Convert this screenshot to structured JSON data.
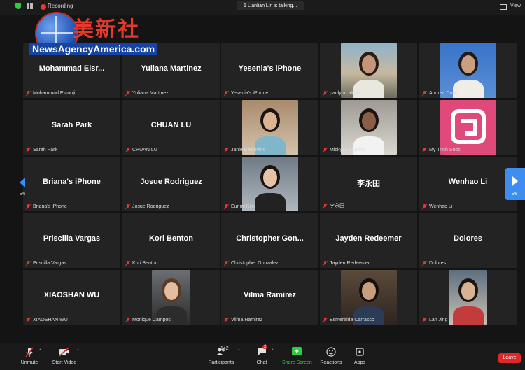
{
  "top_bar": {
    "recording_label": "Recording",
    "talking_indicator": "1 Lianlian Lin is talking...",
    "view_label": "View"
  },
  "watermark": {
    "chinese_text": "美新社",
    "english_text": "NewsAgencyAmerica.com"
  },
  "pagination": {
    "left_page": "5/6",
    "right_page": "5/6"
  },
  "participants": [
    {
      "name": "Mohammad Esrouji",
      "display": "Mohammad  Elsr...",
      "video": false
    },
    {
      "name": "Yuliana Martinez",
      "display": "Yuliana Martinez",
      "video": false
    },
    {
      "name": "Yesenia's iPhone",
      "display": "Yesenia's iPhone",
      "video": false
    },
    {
      "name": "paulynn alipio",
      "display": "",
      "video": true
    },
    {
      "name": "Andrea Colin",
      "display": "",
      "video": true
    },
    {
      "name": "Sarah Park",
      "display": "Sarah Park",
      "video": false
    },
    {
      "name": "CHUAN LU",
      "display": "CHUAN LU",
      "video": false
    },
    {
      "name": "Janie Baldovino",
      "display": "",
      "video": true
    },
    {
      "name": "Mickyas Shawel",
      "display": "",
      "video": true
    },
    {
      "name": "My Trinh Sooc",
      "display": "",
      "video": true
    },
    {
      "name": "Briana's iPhone",
      "display": "Briana's iPhone",
      "video": false
    },
    {
      "name": "Josue Rodriguez",
      "display": "Josue Rodriguez",
      "video": false
    },
    {
      "name": "Eunmi Kim",
      "display": "",
      "video": true
    },
    {
      "name": "李永田",
      "display": "李永田",
      "video": false
    },
    {
      "name": "Wenhao Li",
      "display": "Wenhao Li",
      "video": false
    },
    {
      "name": "Priscilla Vargas",
      "display": "Priscilla Vargas",
      "video": false
    },
    {
      "name": "Kori Benton",
      "display": "Kori Benton",
      "video": false
    },
    {
      "name": "Christopher Gonzalez",
      "display": "Christopher  Gon...",
      "video": false
    },
    {
      "name": "Jayden Redeemer",
      "display": "Jayden Redeemer",
      "video": false
    },
    {
      "name": "Dolores",
      "display": "Dolores",
      "video": false
    },
    {
      "name": "XIAOSHAN WU",
      "display": "XIAOSHAN WU",
      "video": false
    },
    {
      "name": "Monique Campos",
      "display": "",
      "video": true
    },
    {
      "name": "Vilma Ramirez",
      "display": "Vilma Ramirez",
      "video": false
    },
    {
      "name": "Esmeralda Carrasco",
      "display": "",
      "video": true
    },
    {
      "name": "Lan Jing",
      "display": "",
      "video": true
    }
  ],
  "toolbar": {
    "unmute": "Unmute",
    "start_video": "Start Video",
    "participants": "Participants",
    "participants_count": "142",
    "chat": "Chat",
    "chat_badge": "2",
    "share_screen": "Share Screen",
    "reactions": "Reactions",
    "apps": "Apps",
    "leave": "Leave"
  },
  "colors": {
    "accent_blue": "#3d8ef0",
    "leave_red": "#e02828",
    "share_green": "#2ecc40",
    "tile_bg": "#232323"
  }
}
